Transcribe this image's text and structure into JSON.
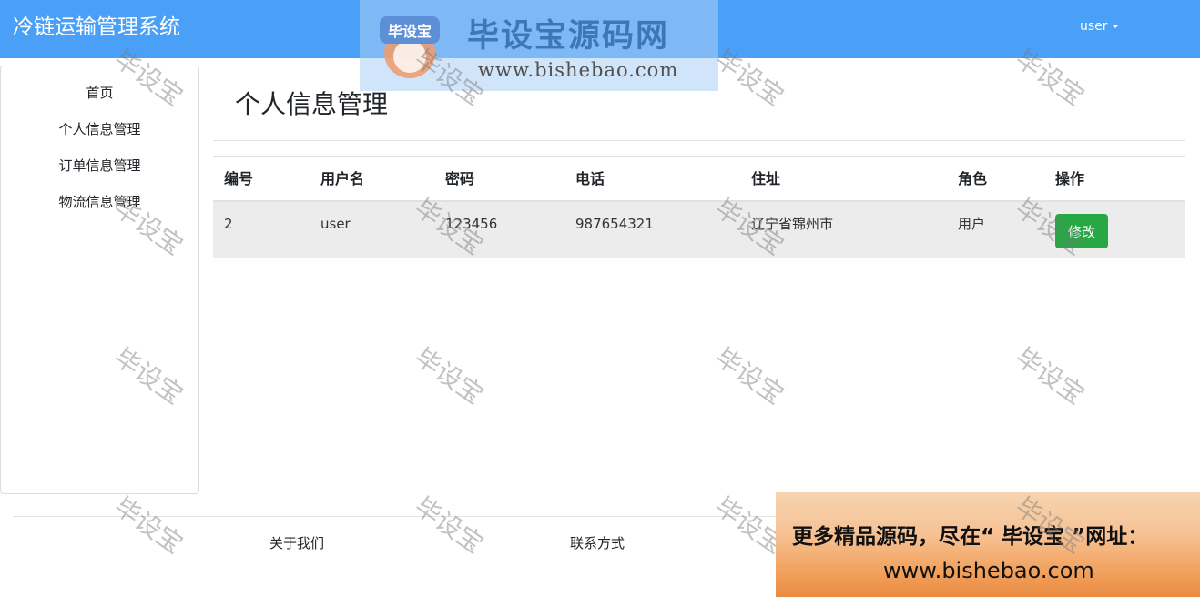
{
  "navbar": {
    "brand": "冷链运输管理系统",
    "user_label": "user"
  },
  "sidebar": {
    "items": [
      {
        "label": "首页"
      },
      {
        "label": "个人信息管理"
      },
      {
        "label": "订单信息管理"
      },
      {
        "label": "物流信息管理"
      }
    ]
  },
  "main": {
    "title": "个人信息管理",
    "table": {
      "headers": [
        "编号",
        "用户名",
        "密码",
        "电话",
        "住址",
        "角色",
        "操作"
      ],
      "rows": [
        {
          "id": "2",
          "username": "user",
          "password": "123456",
          "phone": "987654321",
          "address": "辽宁省锦州市",
          "role": "用户",
          "action_label": "修改"
        }
      ]
    }
  },
  "footer": {
    "links": [
      "关于我们",
      "联系方式"
    ]
  },
  "watermark": {
    "logo_text": "毕设宝",
    "title": "毕设宝源码网",
    "url": "www.bishebao.com",
    "tile_text": "毕设宝"
  },
  "ad": {
    "line1": "更多精品源码，尽在“ 毕设宝 ”网址：",
    "line2": "www.bishebao.com"
  },
  "colors": {
    "navbar": "#4aa0f7",
    "edit_button": "#28a745",
    "row_bg": "#ececec"
  }
}
